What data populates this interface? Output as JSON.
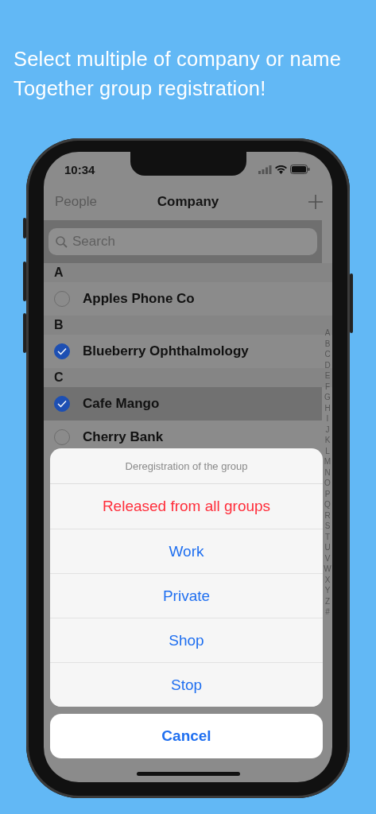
{
  "headline": [
    "Select multiple of company or name",
    "Together group registration!"
  ],
  "status_bar": {
    "time": "10:34"
  },
  "nav": {
    "back": "People",
    "title": "Company"
  },
  "search": {
    "placeholder": "Search"
  },
  "sections": [
    {
      "letter": "A",
      "rows": [
        {
          "name": "Apples Phone Co",
          "checked": false,
          "selected": false
        }
      ]
    },
    {
      "letter": "B",
      "rows": [
        {
          "name": "Blueberry Ophthalmology",
          "checked": true,
          "selected": false
        }
      ]
    },
    {
      "letter": "C",
      "rows": [
        {
          "name": "Cafe Mango",
          "checked": true,
          "selected": true
        },
        {
          "name": "Cherry Bank",
          "checked": false,
          "selected": false
        }
      ]
    }
  ],
  "index": [
    "A",
    "B",
    "C",
    "D",
    "E",
    "F",
    "G",
    "H",
    "I",
    "J",
    "K",
    "L",
    "M",
    "N",
    "O",
    "P",
    "Q",
    "R",
    "S",
    "T",
    "U",
    "V",
    "W",
    "X",
    "Y",
    "Z",
    "#"
  ],
  "action_sheet": {
    "title": "Deregistration of the group",
    "actions": [
      {
        "label": "Released from all groups",
        "kind": "destructive"
      },
      {
        "label": "Work",
        "kind": "default"
      },
      {
        "label": "Private",
        "kind": "default"
      },
      {
        "label": "Shop",
        "kind": "default"
      },
      {
        "label": "Stop",
        "kind": "default"
      }
    ],
    "cancel": "Cancel"
  }
}
